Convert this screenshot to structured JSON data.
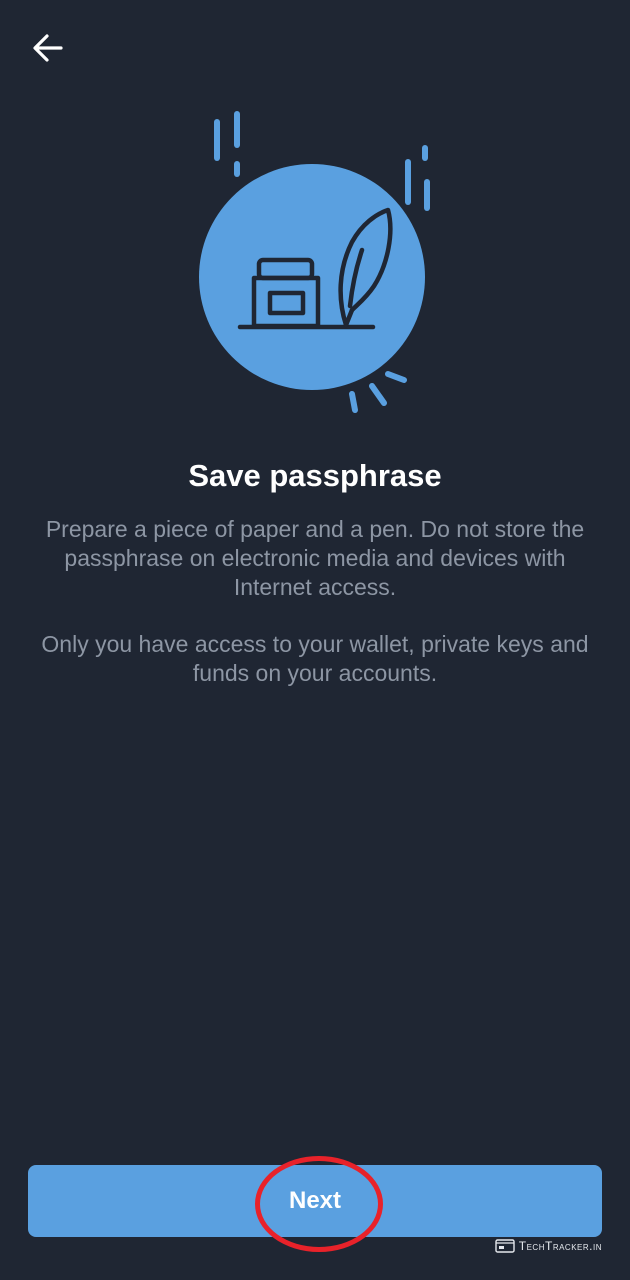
{
  "screen": {
    "title": "Save passphrase",
    "description_1": "Prepare a piece of paper and a pen. Do not store the passphrase on electronic media and devices with Internet access.",
    "description_2": "Only you have access to your wallet, private keys and funds on your accounts."
  },
  "header": {
    "back_icon": "arrow-left-icon"
  },
  "illustration": {
    "icon": "inkwell-quill-icon"
  },
  "footer": {
    "next_label": "Next"
  },
  "watermark": {
    "text": "TechTracker.in"
  },
  "colors": {
    "background": "#1f2633",
    "accent": "#5aa0e0",
    "text_primary": "#ffffff",
    "text_secondary": "#8d96a4",
    "highlight": "#e8222a"
  }
}
